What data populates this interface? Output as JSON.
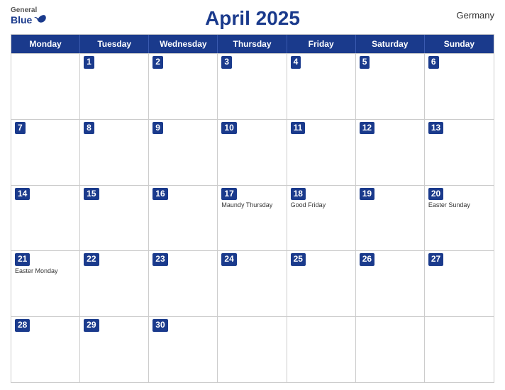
{
  "header": {
    "title": "April 2025",
    "country": "Germany",
    "logo": {
      "general": "General",
      "blue": "Blue"
    }
  },
  "calendar": {
    "days": [
      "Monday",
      "Tuesday",
      "Wednesday",
      "Thursday",
      "Friday",
      "Saturday",
      "Sunday"
    ],
    "rows": [
      [
        {
          "date": "",
          "event": ""
        },
        {
          "date": "1",
          "event": ""
        },
        {
          "date": "2",
          "event": ""
        },
        {
          "date": "3",
          "event": ""
        },
        {
          "date": "4",
          "event": ""
        },
        {
          "date": "5",
          "event": ""
        },
        {
          "date": "6",
          "event": ""
        }
      ],
      [
        {
          "date": "7",
          "event": ""
        },
        {
          "date": "8",
          "event": ""
        },
        {
          "date": "9",
          "event": ""
        },
        {
          "date": "10",
          "event": ""
        },
        {
          "date": "11",
          "event": ""
        },
        {
          "date": "12",
          "event": ""
        },
        {
          "date": "13",
          "event": ""
        }
      ],
      [
        {
          "date": "14",
          "event": ""
        },
        {
          "date": "15",
          "event": ""
        },
        {
          "date": "16",
          "event": ""
        },
        {
          "date": "17",
          "event": "Maundy Thursday"
        },
        {
          "date": "18",
          "event": "Good Friday"
        },
        {
          "date": "19",
          "event": ""
        },
        {
          "date": "20",
          "event": "Easter Sunday"
        }
      ],
      [
        {
          "date": "21",
          "event": "Easter Monday"
        },
        {
          "date": "22",
          "event": ""
        },
        {
          "date": "23",
          "event": ""
        },
        {
          "date": "24",
          "event": ""
        },
        {
          "date": "25",
          "event": ""
        },
        {
          "date": "26",
          "event": ""
        },
        {
          "date": "27",
          "event": ""
        }
      ],
      [
        {
          "date": "28",
          "event": ""
        },
        {
          "date": "29",
          "event": ""
        },
        {
          "date": "30",
          "event": ""
        },
        {
          "date": "",
          "event": ""
        },
        {
          "date": "",
          "event": ""
        },
        {
          "date": "",
          "event": ""
        },
        {
          "date": "",
          "event": ""
        }
      ]
    ]
  }
}
